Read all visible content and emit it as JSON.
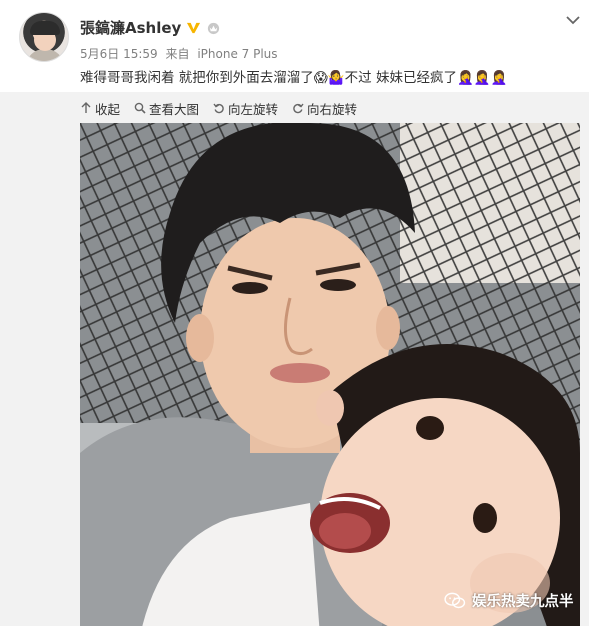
{
  "post": {
    "username": "張鎬濂Ashley",
    "date": "5月6日 15:59",
    "source_prefix": "来自",
    "source_device": "iPhone 7 Plus",
    "text": "难得哥哥我闲着 就把你到外面去溜溜了😱🤷‍♀️不过 妹妹已经疯了🤦‍♀️🤦‍♀️🤦‍♀️"
  },
  "toolbar": {
    "collapse_label": "收起",
    "view_large_label": "查看大图",
    "rotate_left_label": "向左旋转",
    "rotate_right_label": "向右旋转"
  },
  "watermark": {
    "text": "娱乐热卖九点半"
  },
  "icons": {
    "verified": "verified-v-icon",
    "level": "crown-level-icon",
    "more": "chevron-down-icon",
    "collapse": "arrow-up-icon",
    "view_large": "magnifier-icon",
    "rotate_left": "rotate-left-icon",
    "rotate_right": "rotate-right-icon",
    "watermark_logo": "wechat-icon"
  },
  "colors": {
    "verified_badge": "#f7b500",
    "meta_text": "#808080",
    "panel_bg": "#f2f2f2"
  }
}
